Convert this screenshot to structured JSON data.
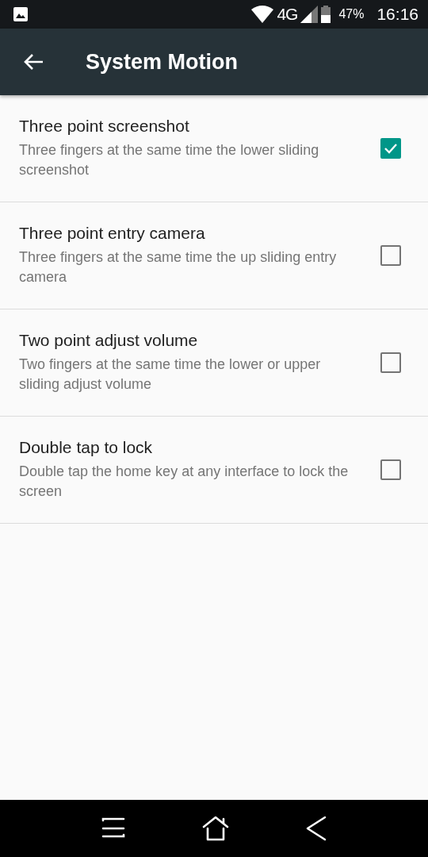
{
  "status_bar": {
    "network": "4G",
    "battery": "47%",
    "time": "16:16"
  },
  "app_bar": {
    "title": "System Motion"
  },
  "settings": [
    {
      "title": "Three point screenshot",
      "summary": "Three fingers at the same time the lower sliding screenshot",
      "checked": true
    },
    {
      "title": "Three point entry camera",
      "summary": "Three fingers at the same time the up sliding entry camera",
      "checked": false
    },
    {
      "title": "Two point adjust volume",
      "summary": "Two fingers at the same time the lower or upper sliding adjust volume",
      "checked": false
    },
    {
      "title": "Double tap to lock",
      "summary": "Double tap the home key at any interface to lock the screen",
      "checked": false
    }
  ]
}
